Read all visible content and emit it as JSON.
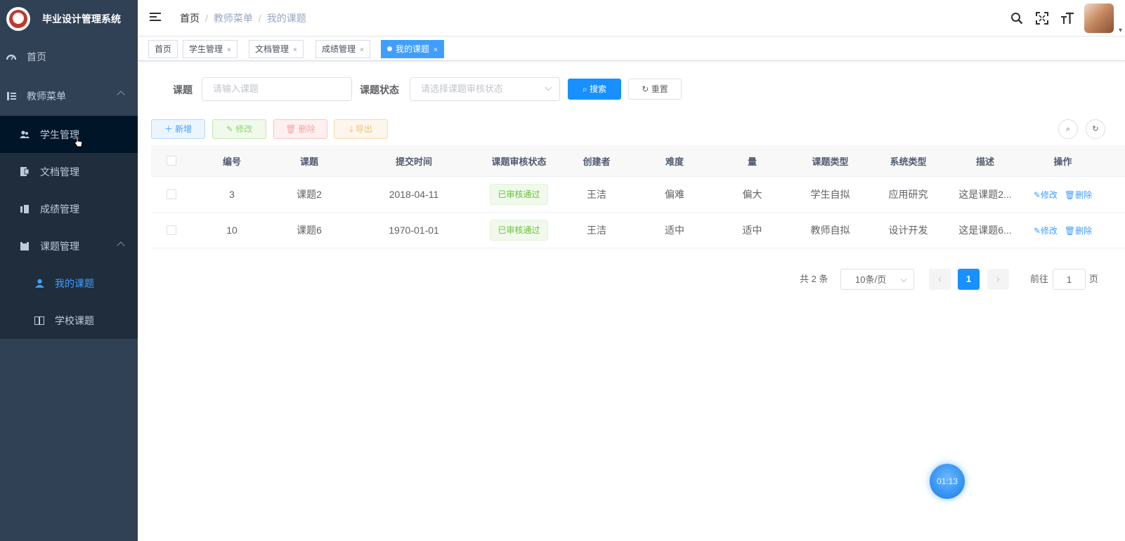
{
  "app": {
    "title": "毕业设计管理系统"
  },
  "sidebar": {
    "items": [
      {
        "label": "首页",
        "icon": "dashboard-icon"
      },
      {
        "label": "教师菜单",
        "icon": "menu-tree-icon"
      },
      {
        "label": "学生管理",
        "icon": "peoples-icon"
      },
      {
        "label": "文档管理",
        "icon": "document-icon"
      },
      {
        "label": "成绩管理",
        "icon": "score-icon"
      },
      {
        "label": "课题管理",
        "icon": "clipboard-icon"
      },
      {
        "label": "我的课题",
        "icon": "user-icon"
      },
      {
        "label": "学校课题",
        "icon": "book-icon"
      }
    ]
  },
  "breadcrumb": {
    "items": [
      "首页",
      "教师菜单",
      "我的课题"
    ],
    "sep": "/"
  },
  "tags": [
    {
      "label": "首页"
    },
    {
      "label": "学生管理",
      "close": "×"
    },
    {
      "label": "文档管理",
      "close": "×"
    },
    {
      "label": "成绩管理",
      "close": "×"
    },
    {
      "label": "我的课题",
      "close": "×"
    }
  ],
  "search": {
    "topic_label": "课题",
    "topic_placeholder": "请输入课题",
    "status_label": "课题状态",
    "status_placeholder": "请选择课题审核状态",
    "search_button": "搜索",
    "reset_button": "重置"
  },
  "toolbar": {
    "add": "新增",
    "edit": "修改",
    "delete": "删除",
    "export": "导出"
  },
  "table": {
    "headers": [
      "编号",
      "课题",
      "提交时间",
      "课题审核状态",
      "创建者",
      "难度",
      "量",
      "课题类型",
      "系统类型",
      "描述",
      "操作"
    ],
    "rows": [
      {
        "id": "3",
        "topic": "课题2",
        "submit_time": "2018-04-11",
        "status": "已审核通过",
        "creator": "王洁",
        "difficulty": "偏难",
        "amount": "偏大",
        "topic_type": "学生自拟",
        "system_type": "应用研究",
        "desc": "这是课题2...",
        "op_edit": "修改",
        "op_delete": "删除"
      },
      {
        "id": "10",
        "topic": "课题6",
        "submit_time": "1970-01-01",
        "status": "已审核通过",
        "creator": "王洁",
        "difficulty": "适中",
        "amount": "适中",
        "topic_type": "教师自拟",
        "system_type": "设计开发",
        "desc": "这是课题6...",
        "op_edit": "修改",
        "op_delete": "删除"
      }
    ]
  },
  "pagination": {
    "total_text": "共 2 条",
    "page_size": "10条/页",
    "current_page": "1",
    "goto_label": "前往",
    "goto_value": "1",
    "page_suffix": "页"
  },
  "timer": {
    "text": "01:13"
  },
  "colors": {
    "sidebar_bg": "#304156",
    "primary": "#409eff",
    "success": "#67c23a"
  }
}
